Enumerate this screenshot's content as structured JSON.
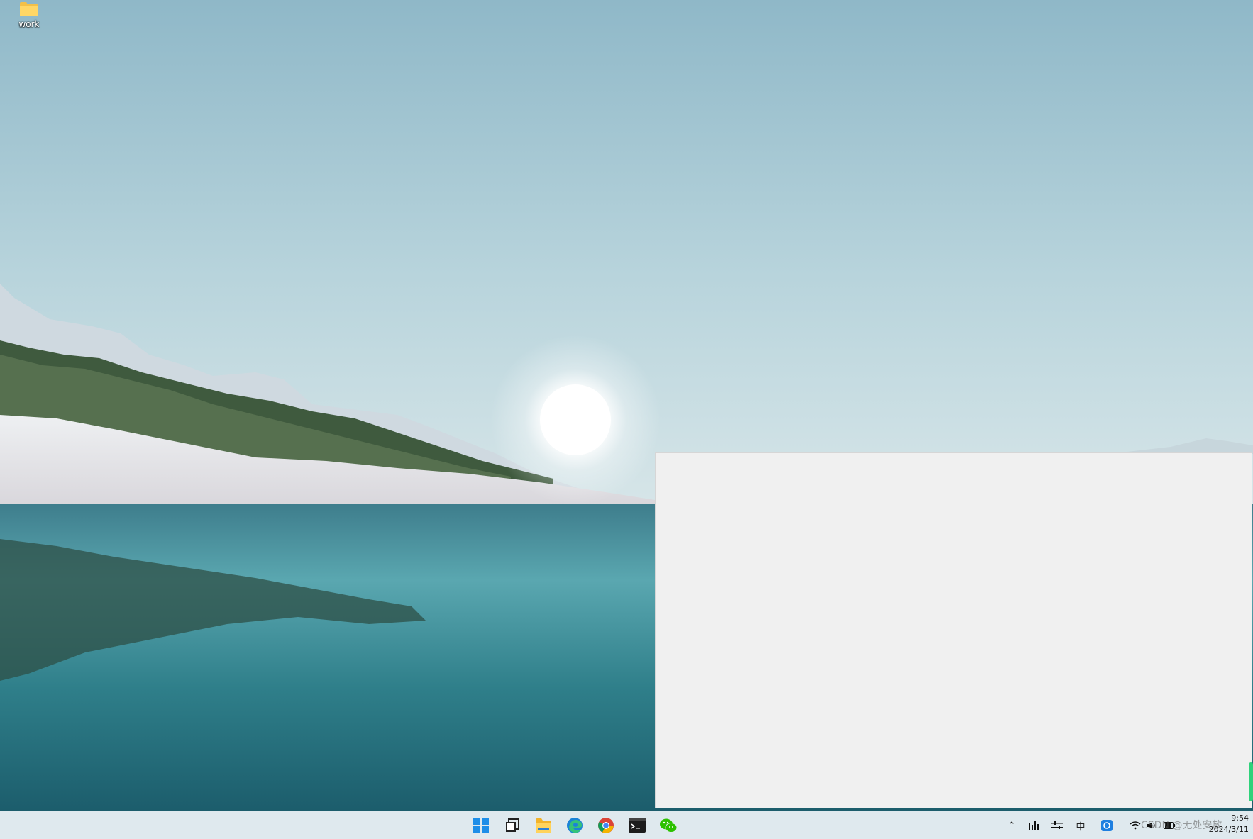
{
  "desktop": {
    "icons": [
      {
        "label": "work",
        "icon": "folder-icon"
      }
    ]
  },
  "taskbar": {
    "apps": [
      {
        "name": "start",
        "icon": "windows-start-icon"
      },
      {
        "name": "task-view",
        "icon": "task-view-icon"
      },
      {
        "name": "file-explorer",
        "icon": "folder-icon"
      },
      {
        "name": "edge",
        "icon": "edge-browser-icon"
      },
      {
        "name": "chrome",
        "icon": "chrome-browser-icon"
      },
      {
        "name": "terminal",
        "icon": "terminal-icon"
      },
      {
        "name": "wechat",
        "icon": "wechat-icon"
      }
    ],
    "tray": {
      "ime_label": "中",
      "clock_time": "9:54",
      "clock_date": "2024/3/11"
    }
  },
  "watermark": "CSDN @无处安放",
  "colors": {
    "taskbar_bg": "#dfe9ee",
    "window_bg": "#f0f0f0",
    "accent_green": "#2fd27b",
    "windows_blue": "#1e8ee8"
  }
}
